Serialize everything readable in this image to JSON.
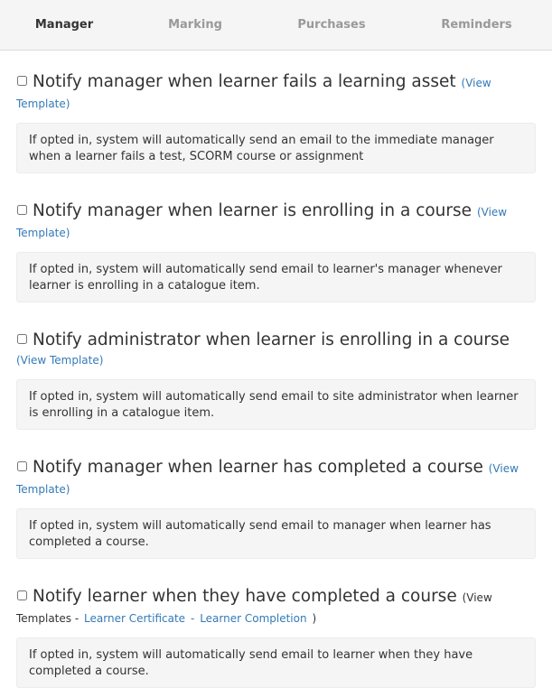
{
  "tabs": [
    {
      "label": "Manager",
      "active": true
    },
    {
      "label": "Marking",
      "active": false
    },
    {
      "label": "Purchases",
      "active": false
    },
    {
      "label": "Reminders",
      "active": false
    }
  ],
  "items": [
    {
      "title": "Notify manager when learner fails a learning asset",
      "link_open": "(View",
      "link_close": "Template)",
      "description": "If opted in, system will automatically send an email to the immediate manager when a learner fails a test, SCORM course or assignment"
    },
    {
      "title": "Notify manager when learner is enrolling in a course",
      "link_open": "(View",
      "link_close": "Template)",
      "description": "If opted in, system will automatically send email to learner's manager whenever learner is enrolling in a catalogue item."
    },
    {
      "title": "Notify administrator when learner is enrolling in a course",
      "link_full": "(View Template)",
      "description": "If opted in, system will automatically send email to site administrator when learner is enrolling in a catalogue item."
    },
    {
      "title": "Notify manager when learner has completed a course",
      "link_open": "(View",
      "link_close": "Template)",
      "description": "If opted in, system will automatically send email to manager when learner has completed a course."
    },
    {
      "title": "Notify learner when they have completed a course",
      "templates_open": "(View",
      "templates_prefix": "Templates -",
      "template_links": [
        "Learner Certificate",
        "Learner Completion"
      ],
      "templates_sep": "-",
      "templates_close": ")",
      "description": "If opted in, system will automatically send email to learner when they have completed a course."
    }
  ]
}
